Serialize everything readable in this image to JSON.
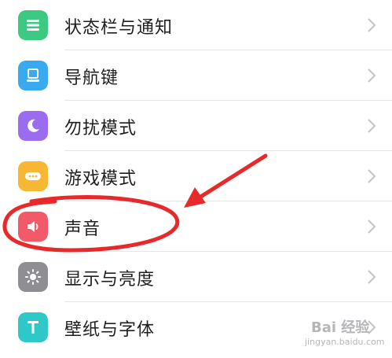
{
  "settings": {
    "items": [
      {
        "label": "状态栏与通知",
        "icon": "notification-list-icon",
        "color": "#3cc981"
      },
      {
        "label": "导航键",
        "icon": "navigation-key-icon",
        "color": "#39a9f0"
      },
      {
        "label": "勿扰模式",
        "icon": "moon-icon",
        "color": "#9c6cf0"
      },
      {
        "label": "游戏模式",
        "icon": "gamepad-icon",
        "color": "#f7b733"
      },
      {
        "label": "声音",
        "icon": "speaker-icon",
        "color": "#f25a6a"
      },
      {
        "label": "显示与亮度",
        "icon": "brightness-icon",
        "color": "#8e8e93"
      },
      {
        "label": "壁纸与字体",
        "icon": "font-t-icon",
        "color": "#2ec8c8"
      }
    ]
  },
  "annotation": {
    "color": "#e8292a"
  },
  "watermark": {
    "main": "Bai 经验",
    "sub": "jingyan.baidu.com"
  }
}
